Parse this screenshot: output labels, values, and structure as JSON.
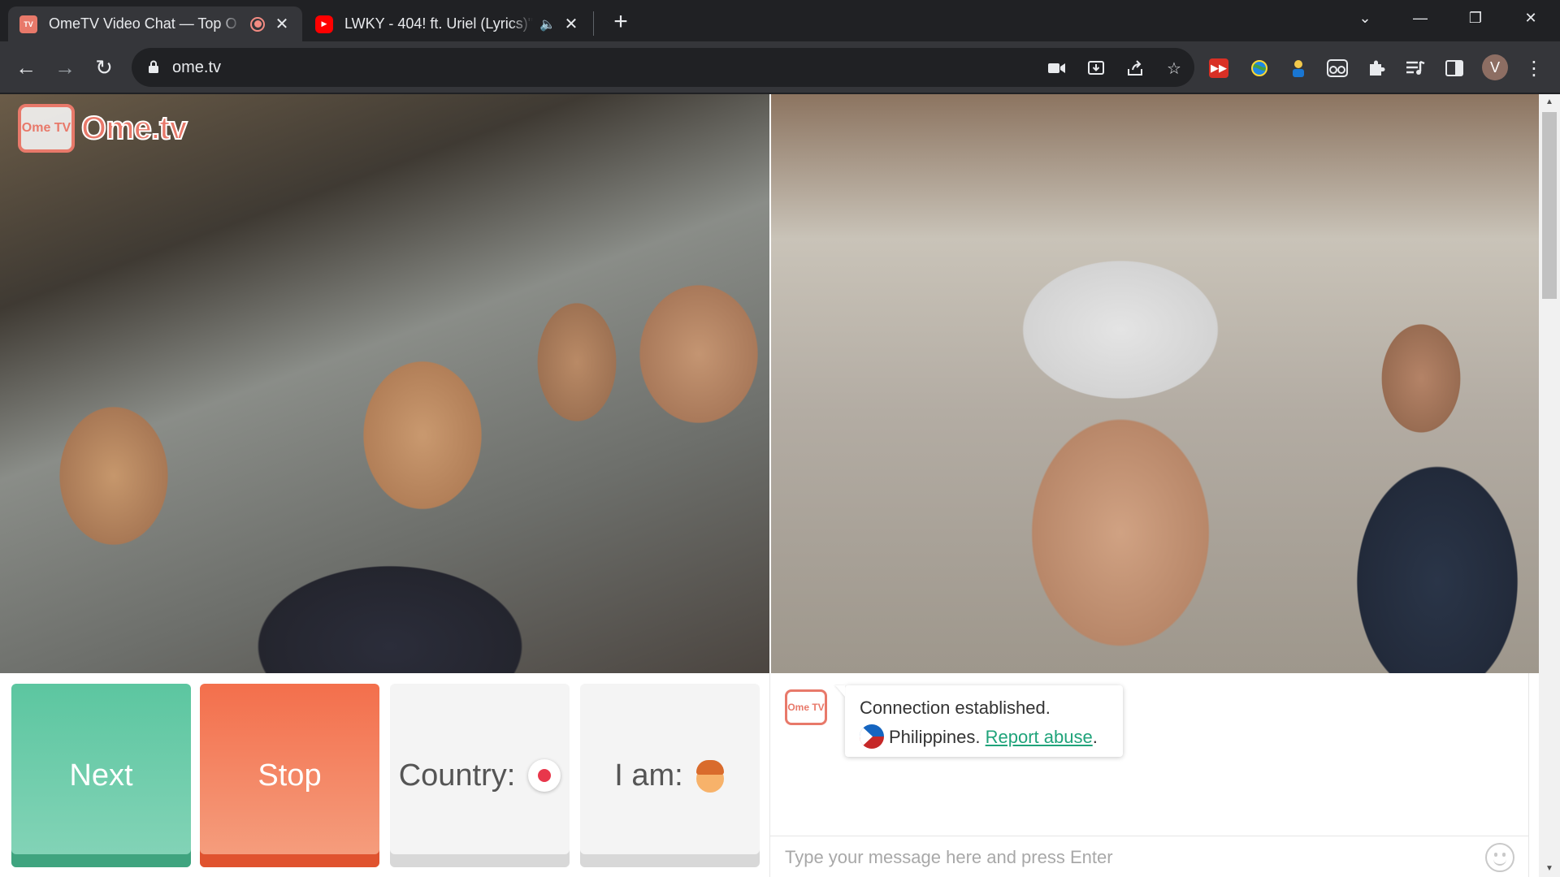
{
  "tabs": [
    {
      "title": "OmeTV Video Chat — Top O",
      "favicon": "ometv-icon",
      "recording": true,
      "active": true
    },
    {
      "title": "LWKY - 404! ft. Uriel (Lyrics)\"|",
      "favicon": "youtube-icon",
      "audio": true,
      "active": false
    }
  ],
  "window_controls": {
    "tab_search": "⌄",
    "minimize": "—",
    "restore": "❐",
    "close": "✕"
  },
  "address_bar": {
    "url": "ome.tv"
  },
  "profile_initial": "V",
  "colors": {
    "next": "#5cc6a0",
    "stop": "#f36f4c",
    "brand": "#e8796a",
    "link": "#1fa37a"
  },
  "watermark": {
    "tv_text": "Ome TV",
    "brand_text": "Ome.tv"
  },
  "buttons": {
    "next": "Next",
    "stop": "Stop",
    "country": "Country:",
    "i_am": "I am:"
  },
  "chat": {
    "logo_text": "Ome TV",
    "message_line1": "Connection established.",
    "country": "Philippines.",
    "report_link": "Report abuse",
    "report_suffix": ".",
    "input_placeholder": "Type your message here and press Enter"
  }
}
